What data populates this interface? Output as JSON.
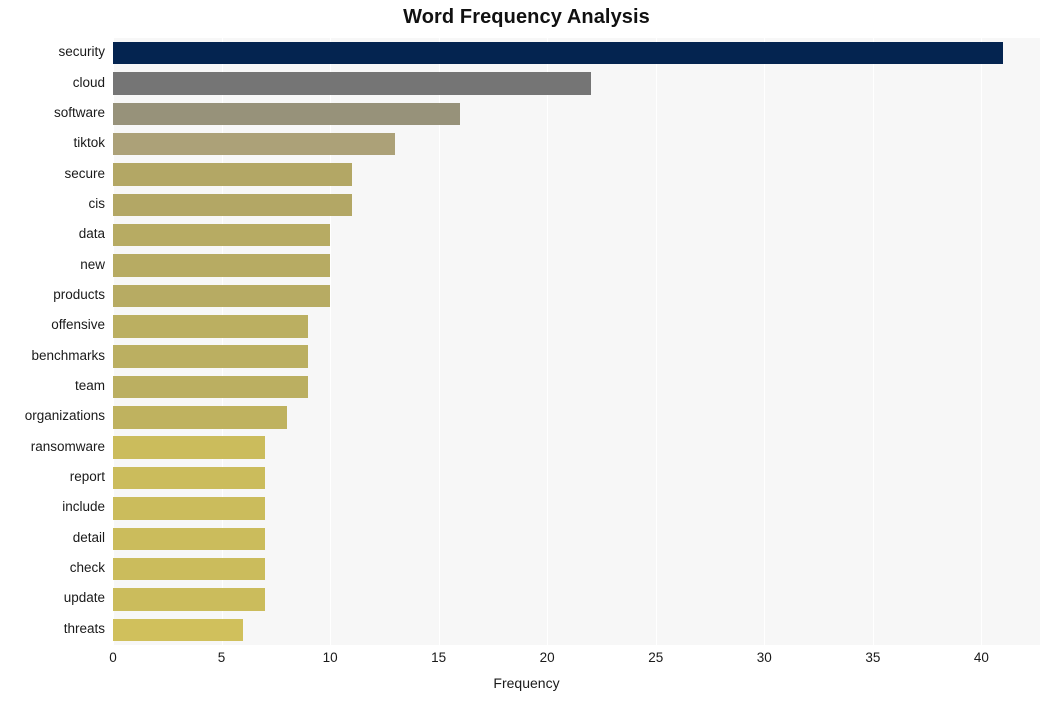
{
  "chart_data": {
    "type": "bar",
    "orientation": "horizontal",
    "title": "Word Frequency Analysis",
    "xlabel": "Frequency",
    "ylabel": "",
    "categories": [
      "security",
      "cloud",
      "software",
      "tiktok",
      "secure",
      "cis",
      "data",
      "new",
      "products",
      "offensive",
      "benchmarks",
      "team",
      "organizations",
      "ransomware",
      "report",
      "include",
      "detail",
      "check",
      "update",
      "threats"
    ],
    "values": [
      41,
      22,
      16,
      13,
      11,
      11,
      10,
      10,
      10,
      9,
      9,
      9,
      8,
      7,
      7,
      7,
      7,
      7,
      7,
      6
    ],
    "bar_colors": [
      "#042450",
      "#757575",
      "#97927a",
      "#aca178",
      "#b3a765",
      "#b3a765",
      "#b7ab63",
      "#b7ab63",
      "#b7ab63",
      "#bbaf61",
      "#bbaf61",
      "#bbaf61",
      "#bfb25f",
      "#cbbc5c",
      "#cbbc5c",
      "#cbbc5c",
      "#cbbc5c",
      "#cbbc5c",
      "#cbbc5c",
      "#d0c05c"
    ],
    "xlim": [
      0,
      42.7
    ],
    "x_ticks": [
      0,
      5,
      10,
      15,
      20,
      25,
      30,
      35,
      40
    ],
    "x_tick_labels": [
      "0",
      "5",
      "10",
      "15",
      "20",
      "25",
      "30",
      "35",
      "40"
    ],
    "grid": true,
    "grid_axis": "x",
    "grid_color": "#ffffff",
    "legend": false,
    "plot_background": "#f7f7f7",
    "figure_background": "#ffffff"
  }
}
